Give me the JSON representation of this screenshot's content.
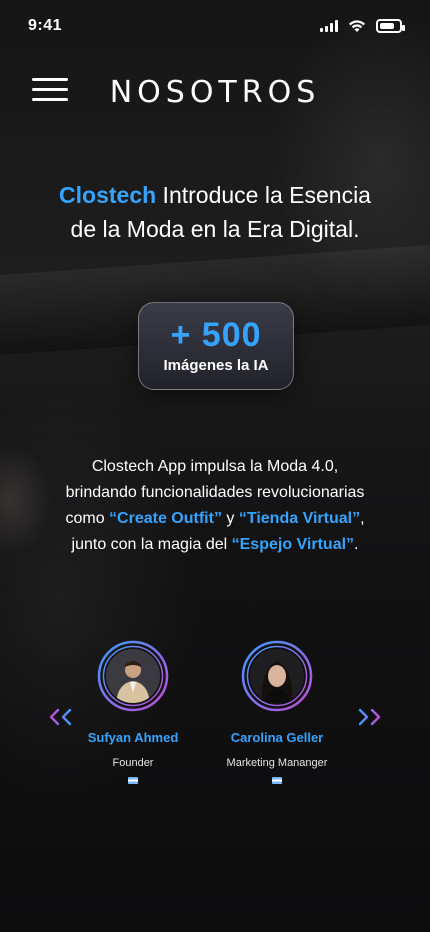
{
  "status_bar": {
    "time": "9:41"
  },
  "header": {
    "title": "NOSOTROS",
    "menu_icon": "hamburger-menu-icon"
  },
  "headline": {
    "brand": "Clostech",
    "line1_rest": " Introduce la Esencia",
    "line2": "de la Moda en la Era Digital."
  },
  "stat_card": {
    "value": "+ 500",
    "label": "Imágenes la IA"
  },
  "description": {
    "line1": "Clostech App impulsa la Moda 4.0,",
    "line2": "brindando funcionalidades revolucionarias",
    "line3_prefix": "como ",
    "feature1": "“Create Outfit”",
    "line3_mid": " y ",
    "feature2": "“Tienda Virtual”",
    "line3_suffix": ",",
    "line4_prefix": "junto con la magia del ",
    "feature3": "“Espejo Virtual”",
    "line4_suffix": "."
  },
  "team": {
    "members": [
      {
        "name": "Sufyan Ahmed",
        "role": "Founder"
      },
      {
        "name": "Carolina Geller",
        "role": "Marketing Mananger"
      }
    ],
    "prev_icon": "double-chevron-left-icon",
    "next_icon": "double-chevron-right-icon"
  },
  "colors": {
    "accent": "#36a4ff",
    "ring_start": "#3b9cff",
    "ring_end": "#c44bd6"
  }
}
